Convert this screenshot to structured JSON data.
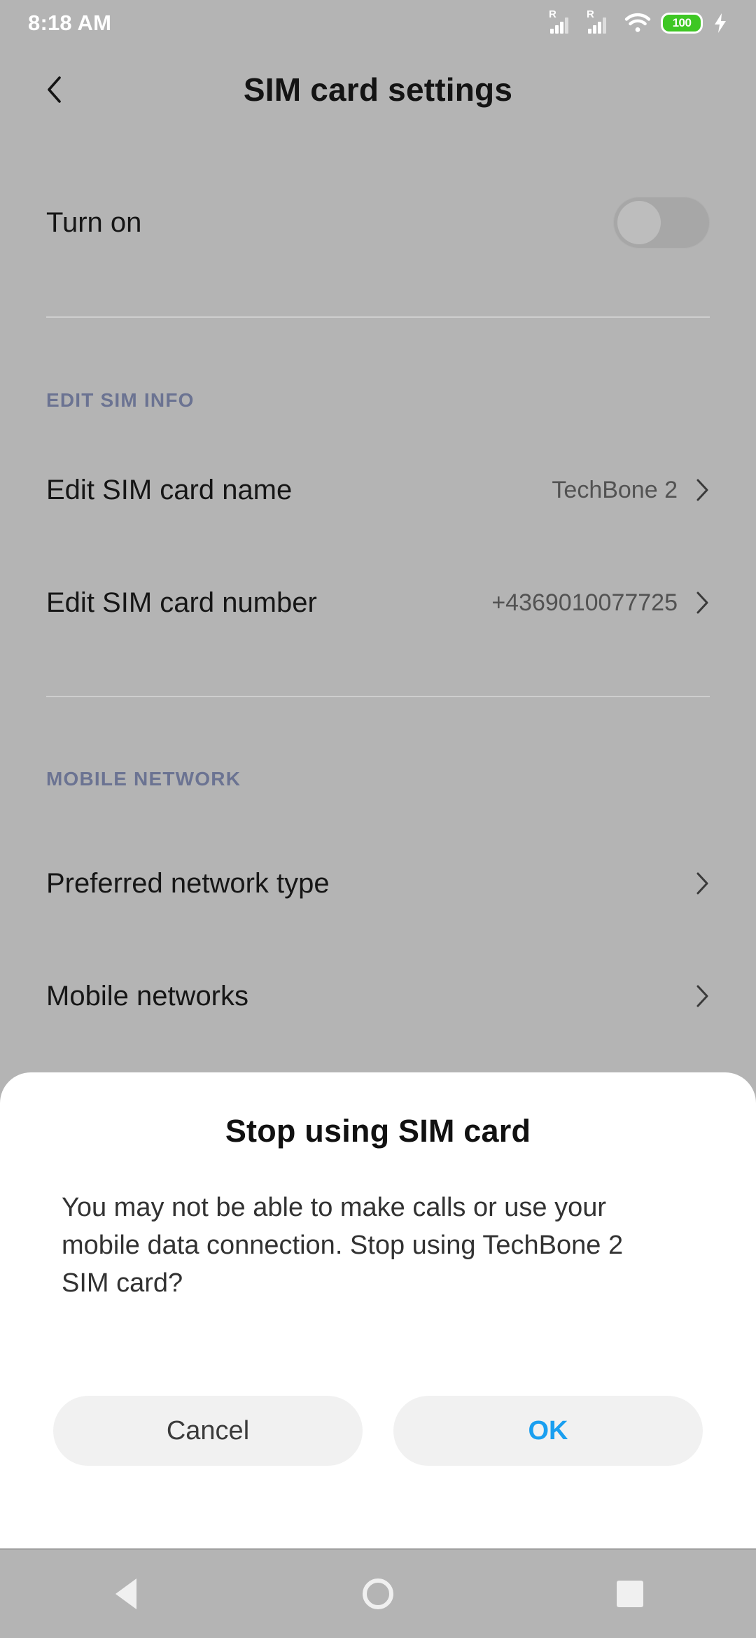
{
  "status_bar": {
    "time": "8:18 AM",
    "signal_1_roaming": "R",
    "signal_2_roaming": "R",
    "wifi_icon": "wifi-icon",
    "battery_percent": "100",
    "charging_icon": "charging-bolt-icon"
  },
  "app_bar": {
    "back_icon": "back-chevron-icon",
    "title": "SIM card settings"
  },
  "settings": {
    "turn_on": {
      "label": "Turn on",
      "toggle_state": "off"
    },
    "sections": [
      {
        "header": "EDIT SIM INFO",
        "rows": [
          {
            "label": "Edit SIM card name",
            "value": "TechBone 2"
          },
          {
            "label": "Edit SIM card number",
            "value": "+4369010077725"
          }
        ]
      },
      {
        "header": "MOBILE NETWORK",
        "rows": [
          {
            "label": "Preferred network type",
            "value": ""
          },
          {
            "label": "Mobile networks",
            "value": ""
          }
        ]
      }
    ]
  },
  "dialog": {
    "title": "Stop using SIM card",
    "message": "You may not be able to make calls or use your mobile data connection. Stop using TechBone 2 SIM card?",
    "cancel_label": "Cancel",
    "ok_label": "OK",
    "ok_color": "#1a9ff0"
  },
  "nav_bar": {
    "back": "nav-back-icon",
    "home": "nav-home-icon",
    "recents": "nav-recents-icon"
  }
}
